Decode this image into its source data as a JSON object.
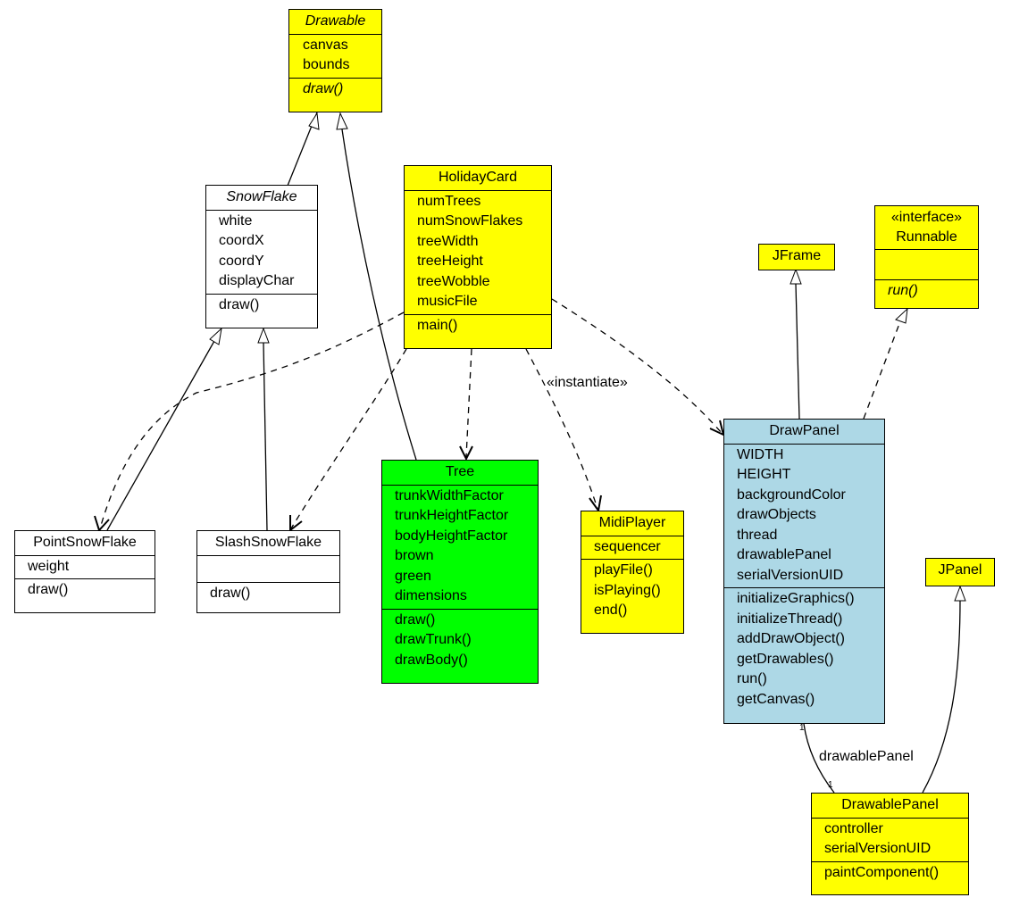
{
  "diagram": {
    "type": "UML class diagram",
    "colors": {
      "abstract_or_external": "#ffff00",
      "snowflake_family": "#ffffff",
      "tree": "#00ff00",
      "draw_panel": "#add8e6",
      "stroke": "#000000"
    },
    "classes": {
      "drawable": {
        "name": "Drawable",
        "abstract": true,
        "attributes": [
          "canvas",
          "bounds"
        ],
        "operations": [
          "draw()"
        ]
      },
      "snowflake": {
        "name": "SnowFlake",
        "abstract": true,
        "attributes": [
          "white",
          "coordX",
          "coordY",
          "displayChar"
        ],
        "operations": [
          "draw()"
        ]
      },
      "holidaycard": {
        "name": "HolidayCard",
        "attributes": [
          "numTrees",
          "numSnowFlakes",
          "treeWidth",
          "treeHeight",
          "treeWobble",
          "musicFile"
        ],
        "operations": [
          "main()"
        ]
      },
      "jframe": {
        "name": "JFrame"
      },
      "runnable": {
        "stereotype": "«interface»",
        "name": "Runnable",
        "attributes": [],
        "operations": [
          "run()"
        ]
      },
      "drawpanel": {
        "name": "DrawPanel",
        "attributes": [
          "WIDTH",
          "HEIGHT",
          "backgroundColor",
          "drawObjects",
          "thread",
          "drawablePanel",
          "serialVersionUID"
        ],
        "operations": [
          "initializeGraphics()",
          "initializeThread()",
          "addDrawObject()",
          "getDrawables()",
          "run()",
          "getCanvas()"
        ]
      },
      "tree": {
        "name": "Tree",
        "attributes": [
          "trunkWidthFactor",
          "trunkHeightFactor",
          "bodyHeightFactor",
          "brown",
          "green",
          "dimensions"
        ],
        "operations": [
          "draw()",
          "drawTrunk()",
          "drawBody()"
        ]
      },
      "midiplayer": {
        "name": "MidiPlayer",
        "attributes": [
          "sequencer"
        ],
        "operations": [
          "playFile()",
          "isPlaying()",
          "end()"
        ]
      },
      "pointsnowflake": {
        "name": "PointSnowFlake",
        "attributes": [
          "weight"
        ],
        "operations": [
          "draw()"
        ]
      },
      "slashsnowflake": {
        "name": "SlashSnowFlake",
        "attributes": [],
        "operations": [
          "draw()"
        ]
      },
      "jpanel": {
        "name": "JPanel"
      },
      "drawablepanel": {
        "name": "DrawablePanel",
        "attributes": [
          "controller",
          "serialVersionUID"
        ],
        "operations": [
          "paintComponent()"
        ]
      }
    },
    "relationships": [
      {
        "kind": "generalization",
        "from": "SnowFlake",
        "to": "Drawable"
      },
      {
        "kind": "generalization",
        "from": "Tree",
        "to": "Drawable"
      },
      {
        "kind": "generalization",
        "from": "PointSnowFlake",
        "to": "SnowFlake"
      },
      {
        "kind": "generalization",
        "from": "SlashSnowFlake",
        "to": "SnowFlake"
      },
      {
        "kind": "generalization",
        "from": "DrawPanel",
        "to": "JFrame"
      },
      {
        "kind": "realization",
        "from": "DrawPanel",
        "to": "Runnable"
      },
      {
        "kind": "generalization",
        "from": "DrawablePanel",
        "to": "JPanel"
      },
      {
        "kind": "dependency",
        "from": "HolidayCard",
        "to": "PointSnowFlake"
      },
      {
        "kind": "dependency",
        "from": "HolidayCard",
        "to": "SlashSnowFlake"
      },
      {
        "kind": "dependency",
        "from": "HolidayCard",
        "to": "Tree"
      },
      {
        "kind": "dependency",
        "from": "HolidayCard",
        "to": "MidiPlayer",
        "label": "«instantiate»"
      },
      {
        "kind": "dependency",
        "from": "HolidayCard",
        "to": "DrawPanel"
      },
      {
        "kind": "association",
        "from": "DrawPanel",
        "to": "DrawablePanel",
        "label": "drawablePanel",
        "from_mult": "1",
        "to_mult": "1"
      }
    ],
    "labels": {
      "instantiate": "«instantiate»",
      "drawable_panel_role": "drawablePanel",
      "mult_drawpanel_end": "1",
      "mult_drawablepanel_end": "1"
    }
  }
}
